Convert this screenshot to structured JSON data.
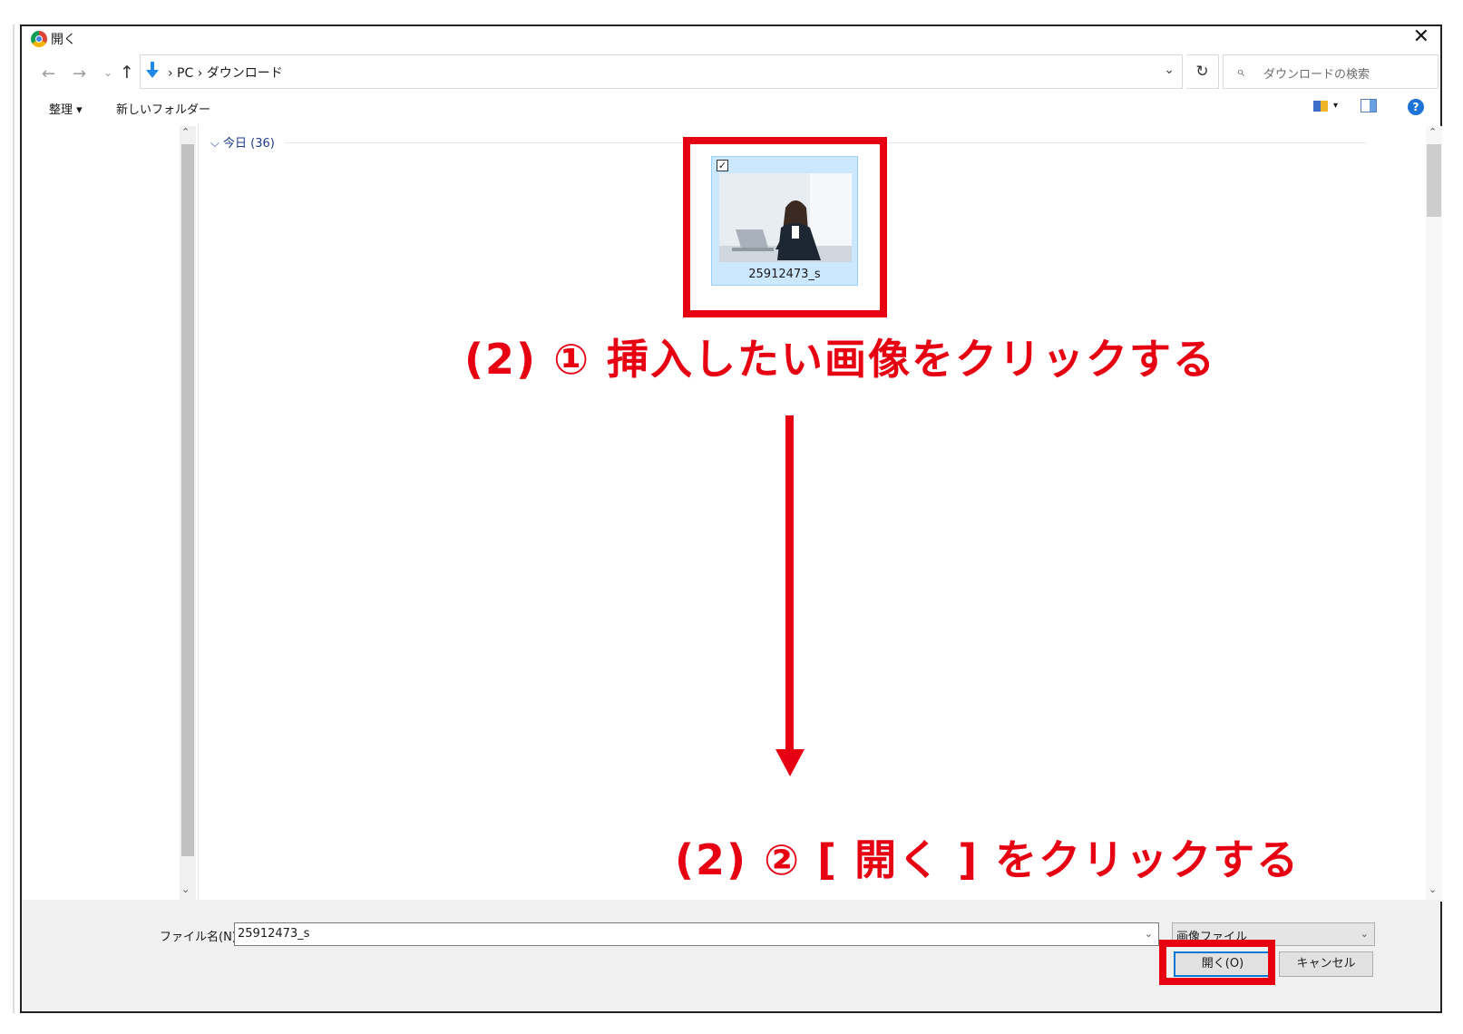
{
  "window": {
    "title": "開く",
    "close_glyph": "✕"
  },
  "nav": {
    "back": "←",
    "forward": "→",
    "recent": "⌄",
    "up": "↑"
  },
  "address": {
    "path": "›  PC  ›  ダウンロード",
    "dropdown": "⌄",
    "refresh": "↻"
  },
  "search": {
    "placeholder": "ダウンロードの検索",
    "icon": "⌕"
  },
  "toolbar": {
    "organize": "整理 ▾",
    "new_folder": "新しいフォルダー",
    "view_dropdown": "▾",
    "help": "?"
  },
  "scroll": {
    "up": "⌃",
    "down": "⌄"
  },
  "content": {
    "group_header": "⌵ 今日 (36)",
    "file": {
      "name": "25912473_s",
      "checked": "✓"
    }
  },
  "annotations": {
    "step1": "(2) ① 挿入したい画像をクリックする",
    "step2": "(2) ② [ 開く ] をクリックする",
    "highlight_color": "#e60012"
  },
  "bottom": {
    "filename_label": "ファイル名(N):",
    "filename_value": "25912473_s",
    "filetype": "画像ファイル",
    "dropdown": "⌄",
    "open_button": "開く(O)",
    "cancel_button": "キャンセル"
  }
}
